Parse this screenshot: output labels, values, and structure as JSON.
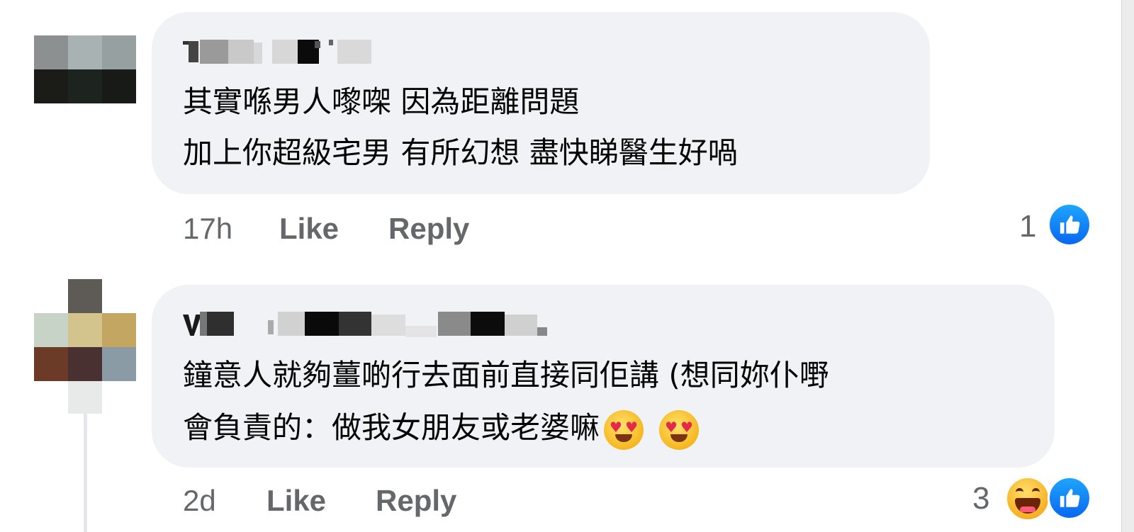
{
  "comments": [
    {
      "author": "T▇▇ ▇ ▇▇",
      "lines": [
        "其實喺男人嚟㗎 因為距離問題",
        "加上你超級宅男 有所幻想 盡快睇醫生好喎"
      ],
      "time": "17h",
      "like_label": "Like",
      "reply_label": "Reply",
      "reaction_count": "1",
      "reactions": [
        "like-icon"
      ]
    },
    {
      "author": "V▇ ▇▇▇ ▇▇▇▇",
      "lines": [
        "鐘意人就夠薑啲行去面前直接同佢講 (想同妳仆嘢",
        "會負責的：做我女朋友或老婆嘛"
      ],
      "emojis": [
        "heart-eyes-emoji",
        "heart-eyes-emoji"
      ],
      "time": "2d",
      "like_label": "Like",
      "reply_label": "Reply",
      "reaction_count": "3",
      "reactions": [
        "haha-icon",
        "like-icon"
      ]
    }
  ],
  "colors": {
    "bubble": "#f0f2f5",
    "meta_text": "#65676b",
    "body_text": "#050505",
    "like_blue": "#0866ff"
  }
}
